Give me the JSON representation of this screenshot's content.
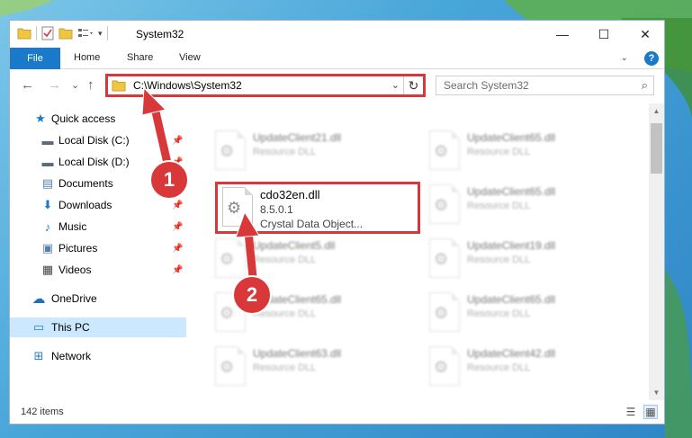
{
  "window": {
    "title": "System32",
    "quick_access_toolbar_icons": [
      "folder-icon",
      "properties-icon",
      "new-folder-icon",
      "customize-icon"
    ]
  },
  "ribbon": {
    "tabs": [
      "File",
      "Home",
      "Share",
      "View"
    ],
    "help_label": "?"
  },
  "nav": {
    "back_icon": "←",
    "forward_icon": "→",
    "recent_icon": "⌄",
    "up_icon": "↑",
    "address": "C:\\Windows\\System32",
    "refresh_icon": "↻",
    "search_placeholder": "Search System32"
  },
  "sidebar": {
    "items": [
      {
        "label": "Quick access",
        "icon": "star-icon",
        "glyph": "★",
        "pinned": false
      },
      {
        "label": "Local Disk (C:)",
        "icon": "drive-icon",
        "glyph": "▬",
        "pinned": true
      },
      {
        "label": "Local Disk (D:)",
        "icon": "drive-icon",
        "glyph": "▬",
        "pinned": true
      },
      {
        "label": "Documents",
        "icon": "documents-icon",
        "glyph": "▤",
        "pinned": true
      },
      {
        "label": "Downloads",
        "icon": "download-icon",
        "glyph": "⬇",
        "pinned": true
      },
      {
        "label": "Music",
        "icon": "music-icon",
        "glyph": "♪",
        "pinned": true
      },
      {
        "label": "Pictures",
        "icon": "pictures-icon",
        "glyph": "▣",
        "pinned": true
      },
      {
        "label": "Videos",
        "icon": "videos-icon",
        "glyph": "▦",
        "pinned": true
      },
      {
        "label": "OneDrive",
        "icon": "cloud-icon",
        "glyph": "☁",
        "pinned": false
      },
      {
        "label": "This PC",
        "icon": "computer-icon",
        "glyph": "▭",
        "pinned": false,
        "selected": true
      },
      {
        "label": "Network",
        "icon": "network-icon",
        "glyph": "⊞",
        "pinned": false
      }
    ]
  },
  "files": {
    "highlighted": {
      "name": "cdo32en.dll",
      "version": "8.5.0.1",
      "description": "Crystal Data Object..."
    },
    "blurred": [
      {
        "name": "UpdateClient21.dll",
        "type": "Resource DLL"
      },
      {
        "name": "UpdateClient65.dll",
        "type": "Resource DLL"
      },
      {
        "name": "UpdateClient65.dll",
        "type": "Resource DLL"
      },
      {
        "name": "UpdateClient5.dll",
        "type": "Resource DLL"
      },
      {
        "name": "UpdateClient19.dll",
        "type": "Resource DLL"
      },
      {
        "name": "UpdateClient65.dll",
        "type": "Resource DLL"
      },
      {
        "name": "UpdateClient65.dll",
        "type": "Resource DLL"
      },
      {
        "name": "UpdateClient63.dll",
        "type": "Resource DLL"
      },
      {
        "name": "UpdateClient42.dll",
        "type": "Resource DLL"
      }
    ]
  },
  "status": {
    "item_count": "142 items"
  },
  "annotations": {
    "step1": "1",
    "step2": "2",
    "color": "#d9383a"
  }
}
